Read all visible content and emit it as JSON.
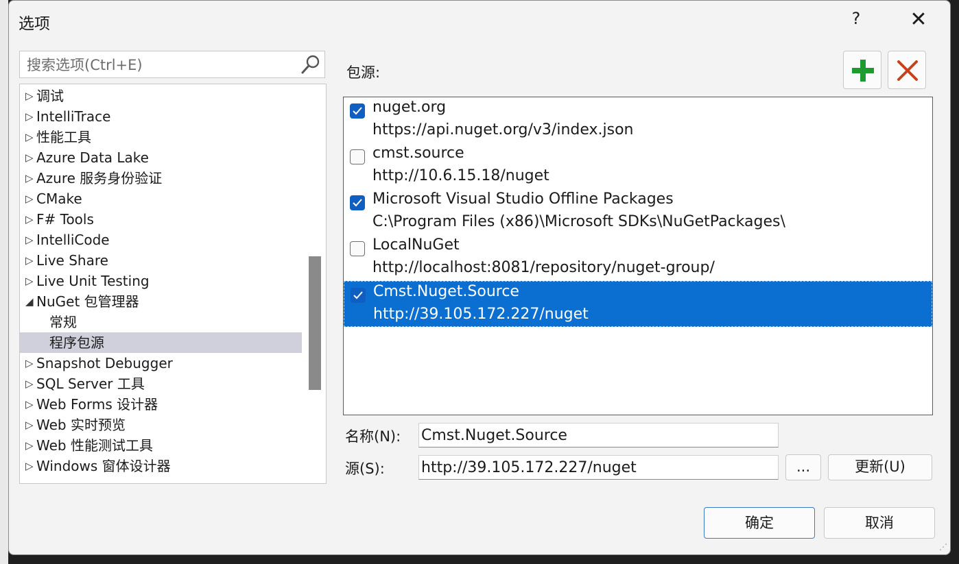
{
  "window": {
    "title": "选项",
    "help_label": "?",
    "close_label": "✕"
  },
  "search": {
    "placeholder": "搜索选项(Ctrl+E)"
  },
  "tree": {
    "items": [
      {
        "label": "调试",
        "expanded": false
      },
      {
        "label": "IntelliTrace",
        "expanded": false
      },
      {
        "label": "性能工具",
        "expanded": false
      },
      {
        "label": "Azure Data Lake",
        "expanded": false
      },
      {
        "label": "Azure 服务身份验证",
        "expanded": false
      },
      {
        "label": "CMake",
        "expanded": false
      },
      {
        "label": "F# Tools",
        "expanded": false
      },
      {
        "label": "IntelliCode",
        "expanded": false
      },
      {
        "label": "Live Share",
        "expanded": false
      },
      {
        "label": "Live Unit Testing",
        "expanded": false
      },
      {
        "label": "NuGet 包管理器",
        "expanded": true
      },
      {
        "label": "常规",
        "child": true
      },
      {
        "label": "程序包源",
        "child": true,
        "selected": true
      },
      {
        "label": "Snapshot Debugger",
        "expanded": false
      },
      {
        "label": "SQL Server 工具",
        "expanded": false
      },
      {
        "label": "Web Forms 设计器",
        "expanded": false
      },
      {
        "label": "Web 实时预览",
        "expanded": false
      },
      {
        "label": "Web 性能测试工具",
        "expanded": false
      },
      {
        "label": "Windows 窗体设计器",
        "expanded": false
      }
    ]
  },
  "sources": {
    "label": "包源:",
    "items": [
      {
        "name": "nuget.org",
        "url": "https://api.nuget.org/v3/index.json",
        "checked": true
      },
      {
        "name": "cmst.source",
        "url": "http://10.6.15.18/nuget",
        "checked": false
      },
      {
        "name": "Microsoft Visual Studio Offline Packages",
        "url": "C:\\Program Files (x86)\\Microsoft SDKs\\NuGetPackages\\",
        "checked": true
      },
      {
        "name": "LocalNuGet",
        "url": "http://localhost:8081/repository/nuget-group/",
        "checked": false
      },
      {
        "name": "Cmst.Nuget.Source",
        "url": "http://39.105.172.227/nuget",
        "checked": true,
        "selected": true
      }
    ]
  },
  "form": {
    "name_label": "名称(N):",
    "name_value": "Cmst.Nuget.Source",
    "source_label": "源(S):",
    "source_value": "http://39.105.172.227/nuget",
    "browse_label": "...",
    "update_label": "更新(U)"
  },
  "footer": {
    "ok_label": "确定",
    "cancel_label": "取消"
  },
  "icons": {
    "add": "plus-icon",
    "remove": "x-icon",
    "search": "search-icon"
  },
  "colors": {
    "accent": "#0a6fd1",
    "add_green": "#1e9b2e",
    "remove_red": "#c7421b"
  }
}
